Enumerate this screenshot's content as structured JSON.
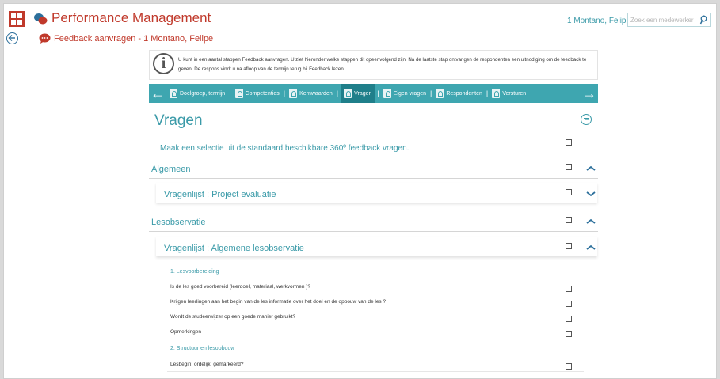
{
  "header": {
    "app_title": "Performance Management",
    "user_name": "1 Montano, Felipe",
    "search_placeholder": "Zoek een medewerker"
  },
  "subheader": {
    "title": "Feedback aanvragen - 1 Montano, Felipe"
  },
  "info": {
    "text": "U kunt in een aantal stappen Feedback aanvragen. U ziet hieronder welke stappen dit opeenvolgend zijn. Na de laatste stap ontvangen de respondenten een uitnodiging om de feedback te geven. De respons vindt u na afloop van de termijn terug bij Feedback lezen."
  },
  "wizard": {
    "steps": [
      {
        "label": "Doelgroep, termijn",
        "active": false
      },
      {
        "label": "Competenties",
        "active": false
      },
      {
        "label": "Kernwaarden",
        "active": false
      },
      {
        "label": "Vragen",
        "active": true
      },
      {
        "label": "Eigen vragen",
        "active": false
      },
      {
        "label": "Respondenten",
        "active": false
      },
      {
        "label": "Versturen",
        "active": false
      }
    ]
  },
  "main": {
    "title": "Vragen",
    "intro": "Maak een selectie uit de standaard beschikbare 360º feedback vragen.",
    "groups": [
      {
        "title": "Algemeen"
      },
      {
        "title": "Vragenlijst : Project evaluatie"
      },
      {
        "title": "Lesobservatie"
      },
      {
        "title": "Vragenlijst : Algemene lesobservatie"
      }
    ],
    "subsections": [
      {
        "title": "1. Lesvoorbereiding"
      },
      {
        "title": "2. Structuur en lesopbouw"
      }
    ],
    "questions": [
      "Is de les goed voorbereid (leerdoel, materiaal, werkvormen )?",
      "Krijgen leerlingen aan het begin van de les informatie over het doel en de opbouw van de les ?",
      "Wordt de studeerwijzer op een goede manier gebruikt?",
      "Opmerkingen",
      "Lesbegin: ordelijk, gemarkeerd?"
    ]
  },
  "colors": {
    "brand_red": "#c0392b",
    "teal": "#3ea6b0",
    "teal_dark": "#1f7f8a",
    "text_teal": "#3a9aa8"
  }
}
